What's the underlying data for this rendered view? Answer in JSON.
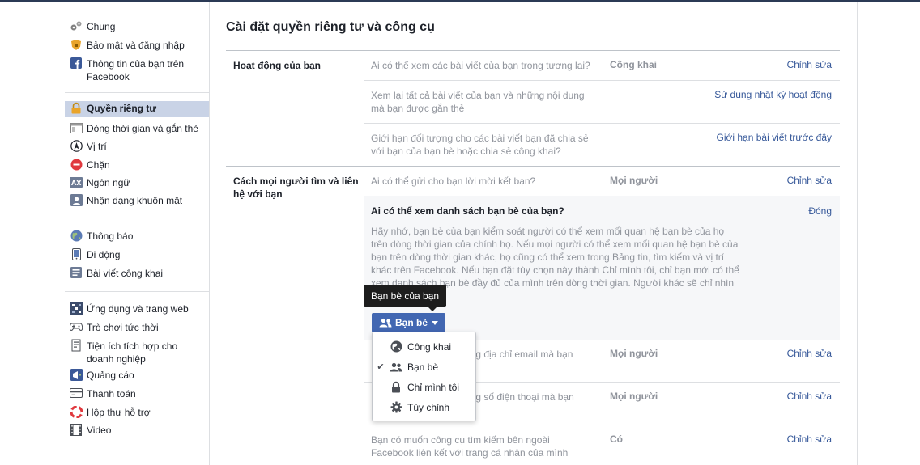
{
  "sidebar": {
    "items": [
      {
        "label": "Chung",
        "icon": "gears-icon"
      },
      {
        "label": "Bảo mật và đăng nhập",
        "icon": "shield-icon"
      },
      {
        "label": "Thông tin của bạn trên",
        "label2": "Facebook",
        "icon": "facebook-icon"
      },
      {
        "label": "Quyền riêng tư",
        "icon": "lock-icon"
      },
      {
        "label": "Dòng thời gian và gắn thẻ",
        "icon": "timeline-icon"
      },
      {
        "label": "Vị trí",
        "icon": "location-icon"
      },
      {
        "label": "Chặn",
        "icon": "block-icon"
      },
      {
        "label": "Ngôn ngữ",
        "icon": "language-icon"
      },
      {
        "label": "Nhận dạng khuôn mặt",
        "icon": "face-recognition-icon"
      },
      {
        "label": "Thông báo",
        "icon": "globe-icon"
      },
      {
        "label": "Di động",
        "icon": "mobile-icon"
      },
      {
        "label": "Bài viết công khai",
        "icon": "rss-icon"
      },
      {
        "label": "Ứng dụng và trang web",
        "icon": "apps-icon"
      },
      {
        "label": "Trò chơi tức thời",
        "icon": "gamepad-icon"
      },
      {
        "label": "Tiện ích tích hợp cho",
        "label2": "doanh nghiệp",
        "icon": "business-icon"
      },
      {
        "label": "Quảng cáo",
        "icon": "ads-icon"
      },
      {
        "label": "Thanh toán",
        "icon": "payments-icon"
      },
      {
        "label": "Hộp thư hỗ trợ",
        "icon": "lifebuoy-icon"
      },
      {
        "label": "Video",
        "icon": "video-icon"
      }
    ],
    "active_index": 3
  },
  "main": {
    "title": "Cài đặt quyền riêng tư và công cụ",
    "sections": [
      {
        "title": "Hoạt động của bạn",
        "rows": [
          {
            "q1": "Ai có thể xem các bài viết của bạn trong tương lai?",
            "value": "Công khai",
            "action": "Chỉnh sửa"
          },
          {
            "q1": "Xem lại tất cả bài viết của bạn và những nội dung",
            "q2": "mà bạn được gắn thẻ",
            "action": "Sử dụng nhật ký hoạt động"
          },
          {
            "q1": "Giới hạn đối tượng cho các bài viết bạn đã chia sẻ",
            "q2": "với bạn của bạn bè hoặc chia sẻ công khai?",
            "action": "Giới hạn bài viết trước đây"
          }
        ]
      },
      {
        "title": "Cách mọi người tìm và liên hệ với bạn",
        "rows": [
          {
            "q1": "Ai có thể gửi cho bạn lời mời kết bạn?",
            "value": "Mọi người",
            "action": "Chỉnh sửa"
          },
          {
            "q1": "ằng địa chỉ email mà bạn",
            "value": "Mọi người",
            "action": "Chỉnh sửa"
          },
          {
            "q1": "ằng số điện thoại mà bạn",
            "value": "Mọi người",
            "action": "Chỉnh sửa"
          },
          {
            "q1": "Bạn có muốn công cụ tìm kiếm bên ngoài",
            "q2": "Facebook liên kết với trang cá nhân của mình",
            "value": "Có",
            "action": "Chỉnh sửa"
          }
        ],
        "expanded": {
          "title": "Ai có thể xem danh sách bạn bè của bạn?",
          "close": "Đóng",
          "body": "Hãy nhớ, bạn bè của bạn kiểm soát người có thể xem mối quan hệ bạn bè của họ trên dòng thời gian của chính họ. Nếu mọi người có thể xem mối quan hệ bạn bè của bạn trên dòng thời gian khác, họ cũng có thể xem trong Bảng tin, tìm kiếm và vị trí khác trên Facebook. Nếu bạn đặt tùy chọn này thành Chỉ mình tôi, chỉ bạn mới có thể xem danh sách bạn bè đầy đủ của mình trên dòng thời gian. Người khác sẽ chỉ nhìn"
        }
      }
    ]
  },
  "tooltip": "Bạn bè của bạn",
  "audience_button": {
    "label": "Bạn bè",
    "icon": "friends-icon"
  },
  "audience_menu": {
    "options": [
      {
        "label": "Công khai",
        "icon": "globe-icon",
        "selected": false
      },
      {
        "label": "Bạn bè",
        "icon": "friends-icon",
        "selected": true
      },
      {
        "label": "Chỉ mình tôi",
        "icon": "lock-icon",
        "selected": false
      },
      {
        "label": "Tùy chỉnh",
        "icon": "gear-icon",
        "selected": false
      }
    ]
  },
  "colors": {
    "accent": "#4267b2",
    "link": "#365899",
    "active_sidebar": "#c9d3e6",
    "muted_text": "#90949c"
  }
}
